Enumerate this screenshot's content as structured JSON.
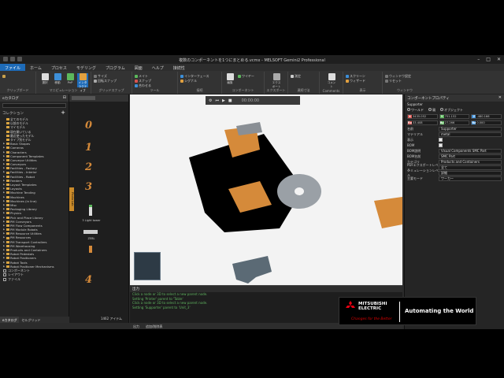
{
  "title": "複数のコンポーネントを1つにまとめる.vcmx - MELSOFT Gemini2 Professional",
  "menu": [
    "ファイル",
    "ホーム",
    "プロセス",
    "モデリング",
    "プログラム",
    "図面",
    "ヘルプ",
    "接続性"
  ],
  "ribbon": {
    "groups": [
      "クリップボード",
      "マニピュレーション",
      "グリッドスナップ",
      "ツール",
      "接続",
      "コンポーネント",
      "エクスポート",
      "連続寸法",
      "Comments",
      "表示",
      "ウィンドウ"
    ],
    "buttons": {
      "select": "選択",
      "move": "移動",
      "pnp": "PnP",
      "interactive": "インタラクティブ",
      "mates": "メイト",
      "snap": "スナップ",
      "align": "合わせる",
      "interfaces": "インターフェース",
      "signals": "シグナル",
      "edit": "編集",
      "wires": "ワイヤー",
      "export": "エクスポート",
      "measure": "測定",
      "comment": "コメント",
      "screen": "スクリーン",
      "wizard": "ウィザード",
      "window": "ウィンドウ設定",
      "reset": "リセット"
    }
  },
  "left": {
    "header": "eカタログ",
    "collections": "コレクション",
    "items": [
      "全てのモデル",
      "以前のモデル",
      "マイモデル",
      "現在開いている",
      "最近使ったモデル",
      "タイプ別モデル",
      "Basic Shapes",
      "Cameras",
      "Characters",
      "Component Templates",
      "Conveyor Utilities",
      "Conveyors",
      "Facilities - Factory",
      "Facilities - Interior",
      "Facilities - Robot",
      "Feeders",
      "Layout Templates",
      "Layouts",
      "Machine Tending",
      "Machines",
      "Machines (in line)",
      "Misc",
      "Packaging Library",
      "Physics",
      "Pick and Place Library",
      "PM Conveyors",
      "PM Flow Components",
      "PM Module Robots",
      "PM Resource Utilities",
      "PM Resources",
      "PM Transport Controllers",
      "PM Warehousing",
      "Products and Containers",
      "Robot Pedestals",
      "Robot Positioners",
      "Robot Tools",
      "Robot Positioner Mechanisms"
    ],
    "checks": [
      "コンポーネント",
      "レイアウト",
      "ファイル"
    ],
    "tabs": [
      "eカタログ",
      "セルグリッド"
    ]
  },
  "mid": {
    "shapes": [
      "0",
      "1",
      "2",
      "3",
      "4"
    ],
    "labels": [
      "3 Light tower",
      "ZEBL"
    ],
    "count": "1462 アイテム",
    "tab": "Photo Lab"
  },
  "viewport": {
    "time": "00:00:00"
  },
  "output": {
    "title": "出力",
    "lines": [
      "Click a node or 3D to select a new parent node.",
      "Setting 'Printer' parent to 'Table'",
      "Click a node or 3D to select a new parent node.",
      "Setting 'Supporter' parent to 'Unit_3'"
    ],
    "tabs": [
      "出力",
      "追加/削除表"
    ]
  },
  "right": {
    "header": "コンポーネントプロパティ",
    "name_sub": "Supporter",
    "coord_options": [
      "ワールド",
      "親",
      "オブジェクト"
    ],
    "coords": [
      [
        "X",
        "3435.052"
      ],
      [
        "Y",
        "751.152"
      ],
      [
        "Z",
        "-480.166"
      ],
      [
        "Rx",
        "33.408"
      ],
      [
        "Ry",
        "27.266"
      ],
      [
        "Rz",
        "0.000"
      ]
    ],
    "props": [
      [
        "名前",
        "Supporter"
      ],
      [
        "マテリアル",
        "metal"
      ],
      [
        "表示",
        ""
      ],
      [
        "BOM",
        ""
      ],
      [
        "BOM説明",
        "Visual Components SMC Part"
      ],
      [
        "BOM名前",
        "SMC Part"
      ],
      [
        "カテゴリ",
        "Products and Containers"
      ],
      [
        "PDFエクスポートレベル",
        "全て"
      ],
      [
        "シミュレーションレベル",
        "詳細"
      ],
      [
        "主要モード",
        "ワーカー"
      ]
    ]
  },
  "banner": {
    "company_line1": "MITSUBISHI",
    "company_line2": "ELECTRIC",
    "tagline": "Changes for the Better",
    "slogan": "Automating the World"
  }
}
